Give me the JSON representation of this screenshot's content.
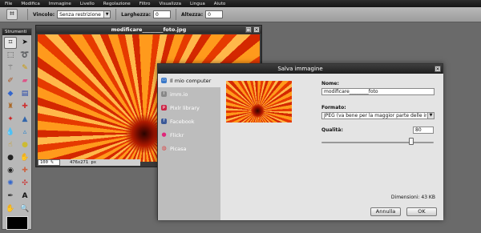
{
  "menubar": {
    "items": [
      "File",
      "Modifica",
      "Immagine",
      "Livello",
      "Regolazione",
      "Filtro",
      "Visualizza",
      "Lingua",
      "Aiuto"
    ]
  },
  "options": {
    "vincolo_label": "Vincolo:",
    "vincolo_value": "Senza restrizione",
    "larghezza_label": "Larghezza:",
    "larghezza_value": "0",
    "altezza_label": "Altezza:",
    "altezza_value": "0"
  },
  "toolbox": {
    "title": "Strumenti",
    "tools": [
      "crop-icon",
      "move-icon",
      "marquee-icon",
      "lasso-icon",
      "wand-icon",
      "pencil-icon",
      "brush-icon",
      "eraser-icon",
      "bucket-icon",
      "gradient-icon",
      "stamp-icon",
      "colour-replace-icon",
      "drawing-icon",
      "shape-icon",
      "blur-icon",
      "sharpen-icon",
      "smudge-icon",
      "sponge-icon",
      "dodge-icon",
      "burn-icon",
      "red-eye-icon",
      "spot-heal-icon",
      "bloat-icon",
      "pinch-icon",
      "picker-icon",
      "type-icon",
      "hand-icon",
      "zoom-icon"
    ]
  },
  "image_window": {
    "title": "modificare________foto.jpg",
    "zoom": "100 %",
    "dimensions": "476x271 px"
  },
  "dialog": {
    "title": "Salva immagine",
    "destinations": [
      {
        "label": "Il mio computer",
        "icon": "computer-icon",
        "color": "#3a78c8"
      },
      {
        "label": "imm.io",
        "icon": "immio-icon",
        "color": "#888888"
      },
      {
        "label": "Pixlr library",
        "icon": "pixlr-icon",
        "color": "#c24"
      },
      {
        "label": "Facebook",
        "icon": "facebook-icon",
        "color": "#3b5998"
      },
      {
        "label": "Flickr",
        "icon": "flickr-icon",
        "color": "#e0267a"
      },
      {
        "label": "Picasa",
        "icon": "picasa-icon",
        "color": "#d44"
      }
    ],
    "name_label": "Nome:",
    "name_value": "modificare________foto",
    "format_label": "Formato:",
    "format_value": "JPEG (va bene per la maggior parte delle immagini)",
    "quality_label": "Qualità:",
    "quality_value": "80",
    "quality_fraction": 0.8,
    "dimensions_label": "Dimensioni: 43 KB",
    "cancel_label": "Annulla",
    "ok_label": "OK"
  }
}
